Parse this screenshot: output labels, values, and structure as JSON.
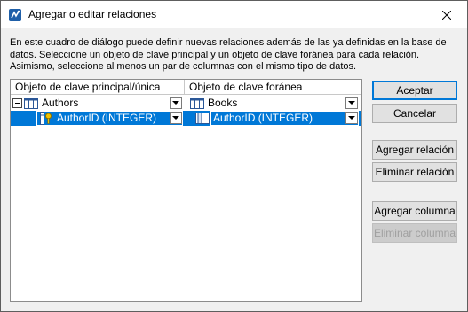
{
  "window": {
    "title": "Agregar o editar relaciones"
  },
  "description": "En este cuadro de diálogo puede definir nuevas relaciones además de las ya definidas en la base de datos. Seleccione un objeto de clave principal y un objeto de clave foránea para cada relación. Asimismo, seleccione al menos un par de columnas con el mismo tipo de datos.",
  "table": {
    "columns": [
      "Objeto de clave principal/única",
      "Objeto de clave foránea"
    ],
    "rows": [
      {
        "primary": "Authors",
        "foreign": "Books",
        "selected": false,
        "expanded": true
      },
      {
        "primary": "AuthorID (INTEGER)",
        "foreign": "AuthorID (INTEGER)",
        "selected": true
      }
    ]
  },
  "buttons": {
    "accept": "Aceptar",
    "cancel": "Cancelar",
    "add_relation": "Agregar relación",
    "remove_relation": "Eliminar relación",
    "add_column": "Agregar columna",
    "remove_column": "Eliminar columna"
  },
  "colors": {
    "selection": "#0078d7",
    "primary_button_border": "#0078d7"
  },
  "icons": {
    "app": "app-icon",
    "close": "close-icon",
    "expander": "collapse-icon",
    "table": "table-icon",
    "key_column": "key-column-icon",
    "column": "column-icon",
    "dropdown": "chevron-down-icon"
  }
}
